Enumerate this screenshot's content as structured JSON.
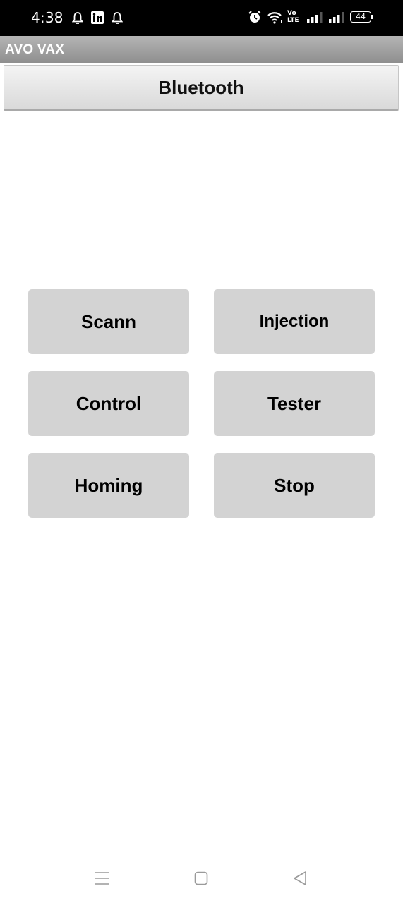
{
  "status_bar": {
    "time": "4:38",
    "battery": "44",
    "network": "Vo LTE"
  },
  "app": {
    "title": "AVO VAX"
  },
  "bluetooth_button": {
    "label": "Bluetooth"
  },
  "buttons": [
    {
      "label": "Scann"
    },
    {
      "label": "Injection"
    },
    {
      "label": "Control"
    },
    {
      "label": "Tester"
    },
    {
      "label": "Homing"
    },
    {
      "label": "Stop"
    }
  ],
  "colors": {
    "status_bar_bg": "#000000",
    "title_bar_bg": "#a0a0a0",
    "button_bg": "#d3d3d3",
    "page_bg": "#ffffff"
  },
  "icons": {
    "notifications": [
      "bell-icon",
      "linkedin-icon",
      "bell-icon"
    ],
    "status": [
      "alarm-icon",
      "wifi-icon",
      "volte-icon",
      "signal-icon",
      "signal-icon",
      "battery-icon"
    ],
    "navigation": [
      "menu-icon",
      "home-icon",
      "back-icon"
    ]
  }
}
